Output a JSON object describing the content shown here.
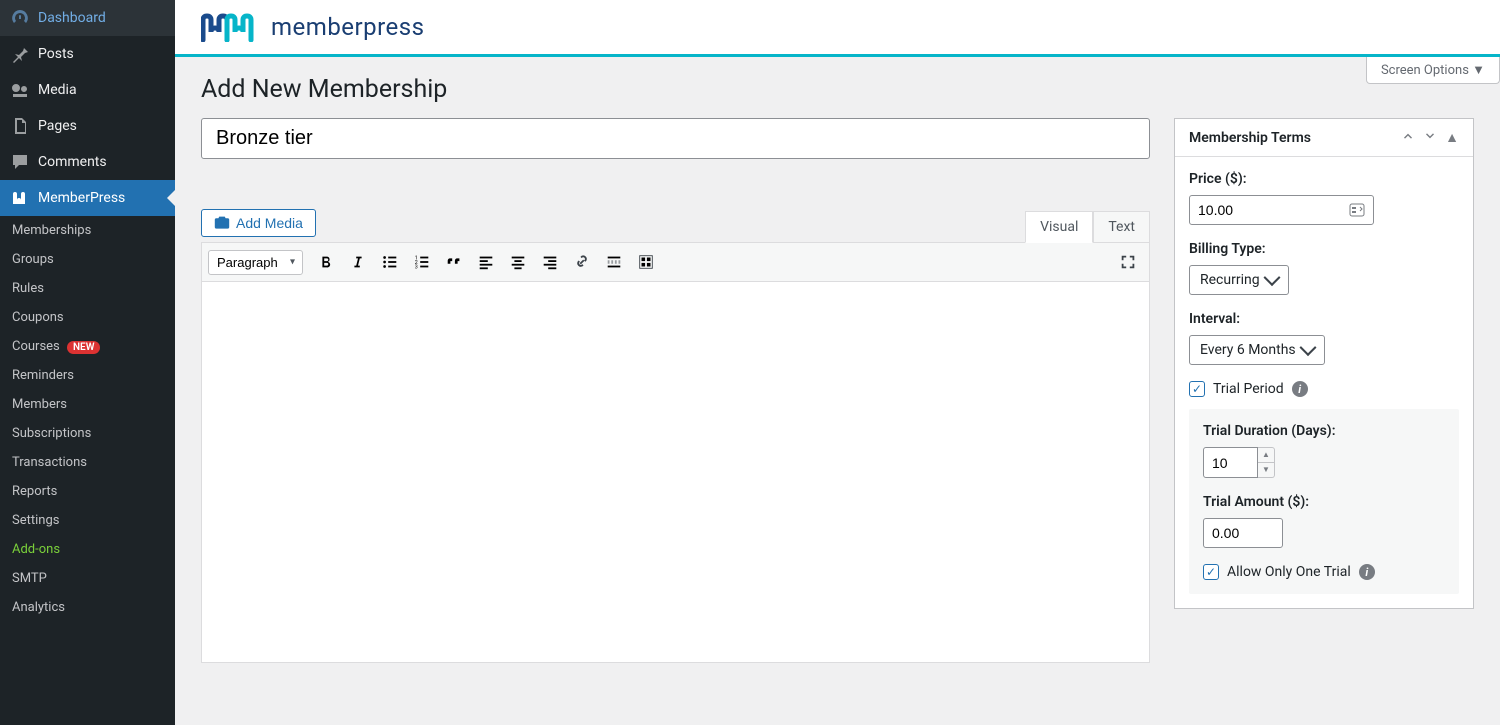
{
  "sidebar": {
    "items": [
      {
        "label": "Dashboard",
        "icon": "dashboard"
      },
      {
        "label": "Posts",
        "icon": "pin"
      },
      {
        "label": "Media",
        "icon": "media"
      },
      {
        "label": "Pages",
        "icon": "pages"
      },
      {
        "label": "Comments",
        "icon": "comment"
      },
      {
        "label": "MemberPress",
        "icon": "mp",
        "active": true
      }
    ],
    "sub_items": [
      {
        "label": "Memberships"
      },
      {
        "label": "Groups"
      },
      {
        "label": "Rules"
      },
      {
        "label": "Coupons"
      },
      {
        "label": "Courses",
        "badge": "NEW"
      },
      {
        "label": "Reminders"
      },
      {
        "label": "Members"
      },
      {
        "label": "Subscriptions"
      },
      {
        "label": "Transactions"
      },
      {
        "label": "Reports"
      },
      {
        "label": "Settings"
      },
      {
        "label": "Add-ons",
        "highlight": true
      },
      {
        "label": "SMTP"
      },
      {
        "label": "Analytics"
      }
    ]
  },
  "brand": "memberpress",
  "screen_options": "Screen Options ▼",
  "page_title": "Add New Membership",
  "title_value": "Bronze tier",
  "add_media": "Add Media",
  "editor_tabs": {
    "visual": "Visual",
    "text": "Text"
  },
  "format_default": "Paragraph",
  "terms": {
    "heading": "Membership Terms",
    "price_label": "Price ($):",
    "price_value": "10.00",
    "billing_label": "Billing Type:",
    "billing_value": "Recurring",
    "interval_label": "Interval:",
    "interval_value": "Every 6 Months",
    "trial_period_label": "Trial Period",
    "trial_duration_label": "Trial Duration (Days):",
    "trial_duration_value": "10",
    "trial_amount_label": "Trial Amount ($):",
    "trial_amount_value": "0.00",
    "allow_one_trial_label": "Allow Only One Trial"
  }
}
